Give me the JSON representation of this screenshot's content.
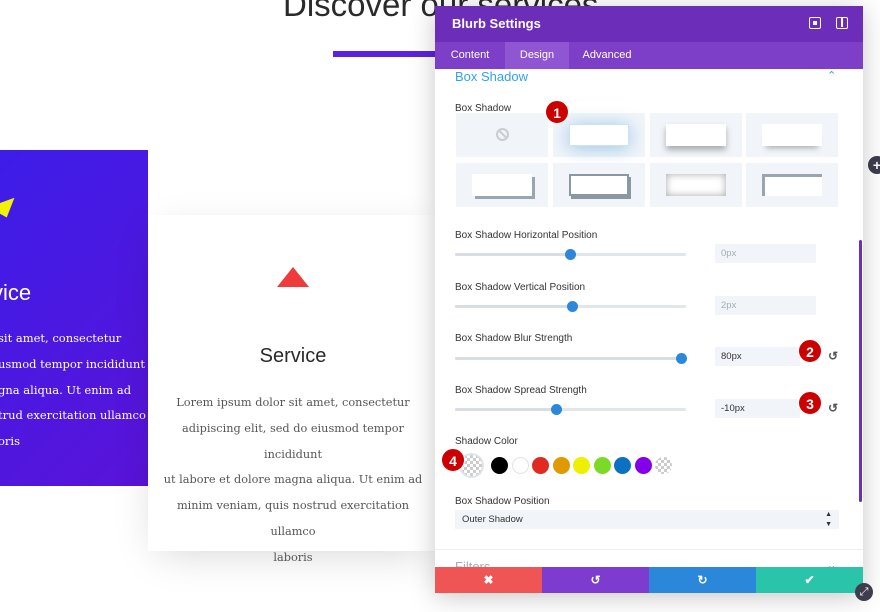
{
  "page": {
    "heading": "Discover our services",
    "card_left": {
      "title": "vice",
      "text": "sit amet, consectetur\nusmod tempor incididunt\ngna aliqua. Ut enim ad\ntrud exercitation ullamco\noris"
    },
    "card_center": {
      "title": "Service",
      "text": "Lorem ipsum dolor sit amet, consectetur\nadipiscing elit, sed do eiusmod tempor incididunt\nut labore et dolore magna aliqua. Ut enim ad\nminim veniam, quis nostrud exercitation ullamco\nlaboris"
    }
  },
  "modal": {
    "title": "Blurb Settings",
    "tabs": [
      {
        "label": "Content",
        "active": false
      },
      {
        "label": "Design",
        "active": true
      },
      {
        "label": "Advanced",
        "active": false
      }
    ],
    "section_title": "Box Shadow",
    "box_shadow_label": "Box Shadow",
    "presets": [
      "none",
      "preset1",
      "preset2",
      "preset3",
      "preset4",
      "preset5",
      "preset6",
      "preset7"
    ],
    "selected_preset": 1,
    "horizontal": {
      "label": "Box Shadow Horizontal Position",
      "value": "0px",
      "placeholder": true,
      "fraction": 0.5
    },
    "vertical": {
      "label": "Box Shadow Vertical Position",
      "value": "2px",
      "placeholder": true,
      "fraction": 0.51
    },
    "blur": {
      "label": "Box Shadow Blur Strength",
      "value": "80px",
      "placeholder": false,
      "fraction": 0.98
    },
    "spread": {
      "label": "Box Shadow Spread Strength",
      "value": "-10px",
      "placeholder": false,
      "fraction": 0.44
    },
    "shadow_color": {
      "label": "Shadow Color",
      "selected": "transparent",
      "swatches": [
        "#000000",
        "#ffffff",
        "#e02b20",
        "#e09900",
        "#edf000",
        "#7cda24",
        "#0c71c3",
        "#8300e9",
        "transparent"
      ]
    },
    "position": {
      "label": "Box Shadow Position",
      "value": "Outer Shadow"
    },
    "filters_title": "Filters"
  },
  "badges": [
    "1",
    "2",
    "3",
    "4"
  ],
  "icons": {
    "expand": "expand-icon",
    "sidebar": "sidebar-toggle-icon",
    "chevron_up": "chevron-up-icon",
    "chevron_down": "chevron-down-icon",
    "reset": "reset-icon",
    "cancel": "close-icon",
    "undo": "undo-icon",
    "redo": "redo-icon",
    "save": "check-icon",
    "plus": "plus-icon",
    "resize": "resize-icon"
  },
  "colors": {
    "header": "#6c2eb9",
    "tabs": "#7d3fc7",
    "accent_blue": "#2b87da",
    "section_title": "#2ea3f2",
    "cancel": "#ef5555",
    "undo": "#7e3bd0",
    "redo": "#2b87da",
    "save": "#29c4a9",
    "badge": "#cc0000"
  }
}
